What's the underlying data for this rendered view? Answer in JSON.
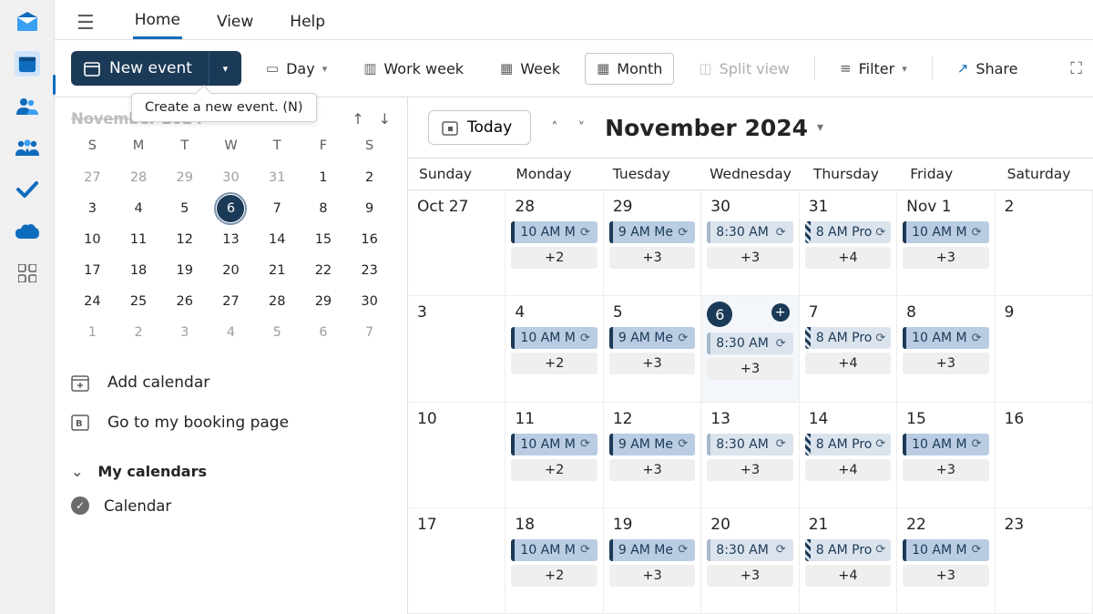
{
  "tabs": {
    "home": "Home",
    "view": "View",
    "help": "Help"
  },
  "toolbar": {
    "new_event": "New event",
    "tooltip": "Create a new event. (N)",
    "day": "Day",
    "work_week": "Work week",
    "week": "Week",
    "month": "Month",
    "split_view": "Split view",
    "filter": "Filter",
    "share": "Share"
  },
  "mini": {
    "title": "November 2024",
    "dows": [
      "S",
      "M",
      "T",
      "W",
      "T",
      "F",
      "S"
    ],
    "rows": [
      [
        {
          "n": "27",
          "out": true
        },
        {
          "n": "28",
          "out": true
        },
        {
          "n": "29",
          "out": true
        },
        {
          "n": "30",
          "out": true
        },
        {
          "n": "31",
          "out": true
        },
        {
          "n": "1"
        },
        {
          "n": "2"
        }
      ],
      [
        {
          "n": "3"
        },
        {
          "n": "4"
        },
        {
          "n": "5"
        },
        {
          "n": "6",
          "today": true
        },
        {
          "n": "7"
        },
        {
          "n": "8"
        },
        {
          "n": "9"
        }
      ],
      [
        {
          "n": "10"
        },
        {
          "n": "11"
        },
        {
          "n": "12"
        },
        {
          "n": "13"
        },
        {
          "n": "14"
        },
        {
          "n": "15"
        },
        {
          "n": "16"
        }
      ],
      [
        {
          "n": "17"
        },
        {
          "n": "18"
        },
        {
          "n": "19"
        },
        {
          "n": "20"
        },
        {
          "n": "21"
        },
        {
          "n": "22"
        },
        {
          "n": "23"
        }
      ],
      [
        {
          "n": "24"
        },
        {
          "n": "25"
        },
        {
          "n": "26"
        },
        {
          "n": "27"
        },
        {
          "n": "28"
        },
        {
          "n": "29"
        },
        {
          "n": "30"
        }
      ],
      [
        {
          "n": "1",
          "out": true
        },
        {
          "n": "2",
          "out": true
        },
        {
          "n": "3",
          "out": true
        },
        {
          "n": "4",
          "out": true
        },
        {
          "n": "5",
          "out": true
        },
        {
          "n": "6",
          "out": true
        },
        {
          "n": "7",
          "out": true
        }
      ]
    ]
  },
  "side": {
    "add_calendar": "Add calendar",
    "booking": "Go to my booking page",
    "my_calendars": "My calendars",
    "calendar": "Calendar"
  },
  "cal": {
    "today_btn": "Today",
    "title": "November 2024",
    "dows": [
      "Sunday",
      "Monday",
      "Tuesday",
      "Wednesday",
      "Thursday",
      "Friday",
      "Saturday"
    ],
    "weeks": [
      [
        {
          "num": "Oct 27"
        },
        {
          "num": "28",
          "events": [
            {
              "style": "blue",
              "t": "10 AM M"
            }
          ],
          "more": "+2"
        },
        {
          "num": "29",
          "events": [
            {
              "style": "blue",
              "t": "9 AM Me"
            }
          ],
          "more": "+3"
        },
        {
          "num": "30",
          "events": [
            {
              "style": "lite",
              "t": "8:30 AM"
            }
          ],
          "more": "+3"
        },
        {
          "num": "31",
          "events": [
            {
              "style": "stripe",
              "t": "8 AM Pro"
            }
          ],
          "more": "+4"
        },
        {
          "num": "Nov 1",
          "events": [
            {
              "style": "blue",
              "t": "10 AM M"
            }
          ],
          "more": "+3"
        },
        {
          "num": "2"
        }
      ],
      [
        {
          "num": "3"
        },
        {
          "num": "4",
          "events": [
            {
              "style": "blue",
              "t": "10 AM M"
            }
          ],
          "more": "+2"
        },
        {
          "num": "5",
          "events": [
            {
              "style": "blue",
              "t": "9 AM Me"
            }
          ],
          "more": "+3"
        },
        {
          "num": "6",
          "today": true,
          "events": [
            {
              "style": "lite",
              "t": "8:30 AM"
            }
          ],
          "more": "+3",
          "add": true
        },
        {
          "num": "7",
          "events": [
            {
              "style": "stripe",
              "t": "8 AM Pro"
            }
          ],
          "more": "+4"
        },
        {
          "num": "8",
          "events": [
            {
              "style": "blue",
              "t": "10 AM M"
            }
          ],
          "more": "+3"
        },
        {
          "num": "9"
        }
      ],
      [
        {
          "num": "10"
        },
        {
          "num": "11",
          "events": [
            {
              "style": "blue",
              "t": "10 AM M"
            }
          ],
          "more": "+2"
        },
        {
          "num": "12",
          "events": [
            {
              "style": "blue",
              "t": "9 AM Me"
            }
          ],
          "more": "+3"
        },
        {
          "num": "13",
          "events": [
            {
              "style": "lite",
              "t": "8:30 AM"
            }
          ],
          "more": "+3"
        },
        {
          "num": "14",
          "events": [
            {
              "style": "stripe",
              "t": "8 AM Pro"
            }
          ],
          "more": "+4"
        },
        {
          "num": "15",
          "events": [
            {
              "style": "blue",
              "t": "10 AM M"
            }
          ],
          "more": "+3"
        },
        {
          "num": "16"
        }
      ],
      [
        {
          "num": "17"
        },
        {
          "num": "18",
          "events": [
            {
              "style": "blue",
              "t": "10 AM M"
            }
          ],
          "more": "+2"
        },
        {
          "num": "19",
          "events": [
            {
              "style": "blue",
              "t": "9 AM Me"
            }
          ],
          "more": "+3"
        },
        {
          "num": "20",
          "events": [
            {
              "style": "lite",
              "t": "8:30 AM"
            }
          ],
          "more": "+3"
        },
        {
          "num": "21",
          "events": [
            {
              "style": "stripe",
              "t": "8 AM Pro"
            }
          ],
          "more": "+4"
        },
        {
          "num": "22",
          "events": [
            {
              "style": "blue",
              "t": "10 AM M"
            }
          ],
          "more": "+3"
        },
        {
          "num": "23"
        }
      ]
    ]
  }
}
